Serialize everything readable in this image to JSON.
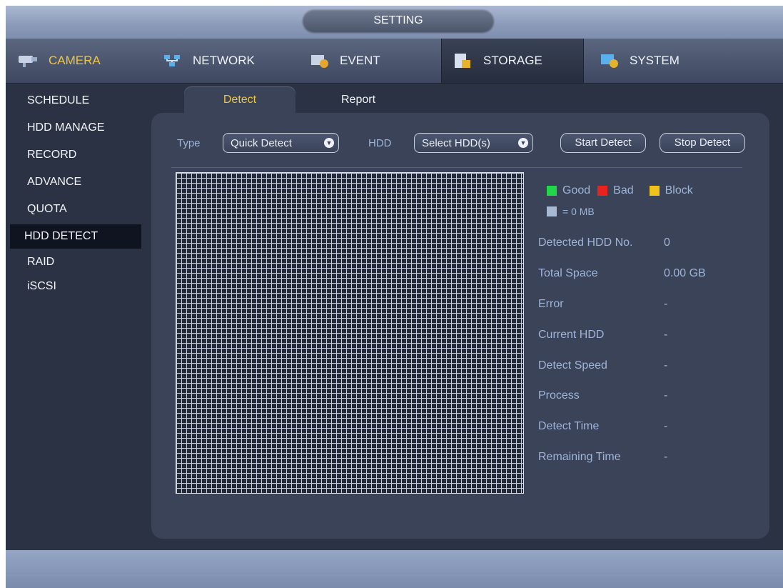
{
  "window": {
    "title": "SETTING"
  },
  "main_tabs": [
    {
      "label": "CAMERA",
      "icon": "camera-icon"
    },
    {
      "label": "NETWORK",
      "icon": "network-icon"
    },
    {
      "label": "EVENT",
      "icon": "event-icon"
    },
    {
      "label": "STORAGE",
      "icon": "storage-icon"
    },
    {
      "label": "SYSTEM",
      "icon": "system-icon"
    }
  ],
  "active_main_tab": "STORAGE",
  "sidebar": {
    "items": [
      {
        "label": "SCHEDULE"
      },
      {
        "label": "HDD MANAGE"
      },
      {
        "label": "RECORD"
      },
      {
        "label": "ADVANCE"
      },
      {
        "label": "QUOTA"
      },
      {
        "label": "HDD DETECT"
      },
      {
        "label": "RAID"
      },
      {
        "label": "iSCSI"
      }
    ],
    "active": "HDD DETECT"
  },
  "sub_tabs": [
    {
      "label": "Detect"
    },
    {
      "label": "Report"
    }
  ],
  "controls": {
    "type_label": "Type",
    "type_value": "Quick Detect",
    "hdd_label": "HDD",
    "hdd_value": "Select HDD(s)",
    "start_button": "Start Detect",
    "stop_button": "Stop Detect"
  },
  "legend": {
    "good": "Good",
    "bad": "Bad",
    "block": "Block",
    "unit": "= 0 MB",
    "colors": {
      "good": "#22d64a",
      "bad": "#e8231e",
      "block": "#f2c21c",
      "unit": "#a9b8d3"
    }
  },
  "info": [
    {
      "label": "Detected HDD No.",
      "value": "0"
    },
    {
      "label": "Total Space",
      "value": "0.00 GB"
    },
    {
      "label": "Error",
      "value": "-"
    },
    {
      "label": "Current HDD",
      "value": "-"
    },
    {
      "label": "Detect Speed",
      "value": "-"
    },
    {
      "label": "Process",
      "value": "-"
    },
    {
      "label": "Detect Time",
      "value": "-"
    },
    {
      "label": "Remaining Time",
      "value": "-"
    }
  ]
}
